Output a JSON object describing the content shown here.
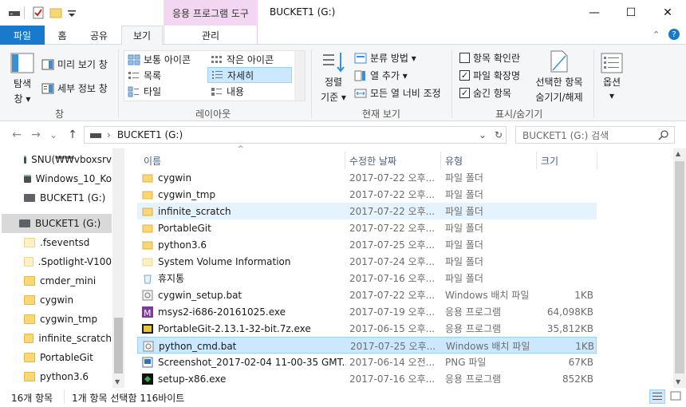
{
  "titlebar": {
    "context_tab": "응용 프로그램 도구",
    "title": "BUCKET1 (G:)",
    "minimize": "—",
    "maximize": "☐",
    "close": "✕"
  },
  "tabs": {
    "file": "파일",
    "home": "홈",
    "share": "공유",
    "view": "보기",
    "manage": "관리"
  },
  "ribbon": {
    "pane": {
      "nav_pane_line1": "탐색",
      "nav_pane_line2": "창 ▾",
      "preview": "미리 보기 창",
      "details": "세부 정보 창",
      "group": "창"
    },
    "layout": {
      "large_icons": "보통 아이콘",
      "small_icons": "작은 아이콘",
      "list": "목록",
      "details": "자세히",
      "tiles": "타일",
      "content": "내용",
      "group": "레이아웃"
    },
    "current_view": {
      "sort_line1": "정렬",
      "sort_line2": "기준 ▾",
      "group_by": "분류 방법 ▾",
      "add_columns": "열 추가 ▾",
      "size_all_columns": "모든 열 너비 조정",
      "group": "현재 보기"
    },
    "show_hide": {
      "item_checkboxes": "항목 확인란",
      "item_checkboxes_checked": "",
      "file_extensions": "파일 확장명",
      "file_extensions_checked": "✓",
      "hidden_items": "숨긴 항목",
      "hidden_items_checked": "✓",
      "hide_selected_line1": "선택한 항목",
      "hide_selected_line2": "숨기기/해제",
      "group": "표시/숨기기"
    },
    "options": {
      "label": "옵션",
      "arrow": "▾"
    }
  },
  "address": {
    "back": "←",
    "forward": "→",
    "recent": "⌄",
    "up": "↑",
    "path_sep": "›",
    "path": "BUCKET1 (G:)",
    "dropdown": "⌄",
    "refresh": "↻",
    "search_placeholder": "BUCKET1 (G:) 검색"
  },
  "nav": {
    "items": [
      {
        "label": "SNU(₩₩vboxsrv",
        "icon": "network-drive-icon"
      },
      {
        "label": "Windows_10_Ko",
        "icon": "network-drive-icon"
      },
      {
        "label": "BUCKET1 (G:)",
        "icon": "drive-icon"
      },
      {
        "label": "BUCKET1 (G:)",
        "icon": "drive-icon"
      },
      {
        "label": ".fseventsd",
        "icon": "folder-icon"
      },
      {
        "label": ".Spotlight-V100",
        "icon": "folder-icon"
      },
      {
        "label": "cmder_mini",
        "icon": "folder-icon"
      },
      {
        "label": "cygwin",
        "icon": "folder-icon"
      },
      {
        "label": "cygwin_tmp",
        "icon": "folder-icon"
      },
      {
        "label": "infinite_scratch",
        "icon": "folder-icon"
      },
      {
        "label": "PortableGit",
        "icon": "folder-icon"
      },
      {
        "label": "python3.6",
        "icon": "folder-icon"
      }
    ]
  },
  "columns": {
    "name": "이름",
    "date": "수정한 날짜",
    "type": "유형",
    "size": "크기",
    "sort_arrow": "^"
  },
  "files": [
    {
      "name": "cygwin",
      "date": "2017-07-22 오후...",
      "type": "파일 폴더",
      "size": "",
      "icon": "folder-icon"
    },
    {
      "name": "cygwin_tmp",
      "date": "2017-07-22 오후...",
      "type": "파일 폴더",
      "size": "",
      "icon": "folder-icon"
    },
    {
      "name": "infinite_scratch",
      "date": "2017-07-22 오후...",
      "type": "파일 폴더",
      "size": "",
      "icon": "folder-icon"
    },
    {
      "name": "PortableGit",
      "date": "2017-07-22 오후...",
      "type": "파일 폴더",
      "size": "",
      "icon": "folder-icon"
    },
    {
      "name": "python3.6",
      "date": "2017-07-25 오후...",
      "type": "파일 폴더",
      "size": "",
      "icon": "folder-icon"
    },
    {
      "name": "System Volume Information",
      "date": "2017-07-24 오후...",
      "type": "파일 폴더",
      "size": "",
      "icon": "system-folder-icon"
    },
    {
      "name": "휴지통",
      "date": "2017-07-16 오후...",
      "type": "파일 폴더",
      "size": "",
      "icon": "recycle-bin-icon"
    },
    {
      "name": "cygwin_setup.bat",
      "date": "2017-07-22 오후...",
      "type": "Windows 배치 파일",
      "size": "1KB",
      "icon": "batch-file-icon"
    },
    {
      "name": "msys2-i686-20161025.exe",
      "date": "2017-07-19 오후...",
      "type": "응용 프로그램",
      "size": "64,098KB",
      "icon": "msys2-icon"
    },
    {
      "name": "PortableGit-2.13.1-32-bit.7z.exe",
      "date": "2017-06-15 오후...",
      "type": "응용 프로그램",
      "size": "35,812KB",
      "icon": "archive-exe-icon"
    },
    {
      "name": "python_cmd.bat",
      "date": "2017-07-25 오후...",
      "type": "Windows 배치 파일",
      "size": "1KB",
      "icon": "batch-file-icon"
    },
    {
      "name": "Screenshot_2017-02-04 11-00-35 GMT...",
      "date": "2017-06-14 오전...",
      "type": "PNG 파일",
      "size": "67KB",
      "icon": "image-file-icon"
    },
    {
      "name": "setup-x86.exe",
      "date": "2017-07-16 오후...",
      "type": "응용 프로그램",
      "size": "852KB",
      "icon": "cygwin-setup-icon"
    }
  ],
  "status": {
    "item_count": "16개 항목",
    "selection": "1개 항목 선택함 116바이트"
  }
}
